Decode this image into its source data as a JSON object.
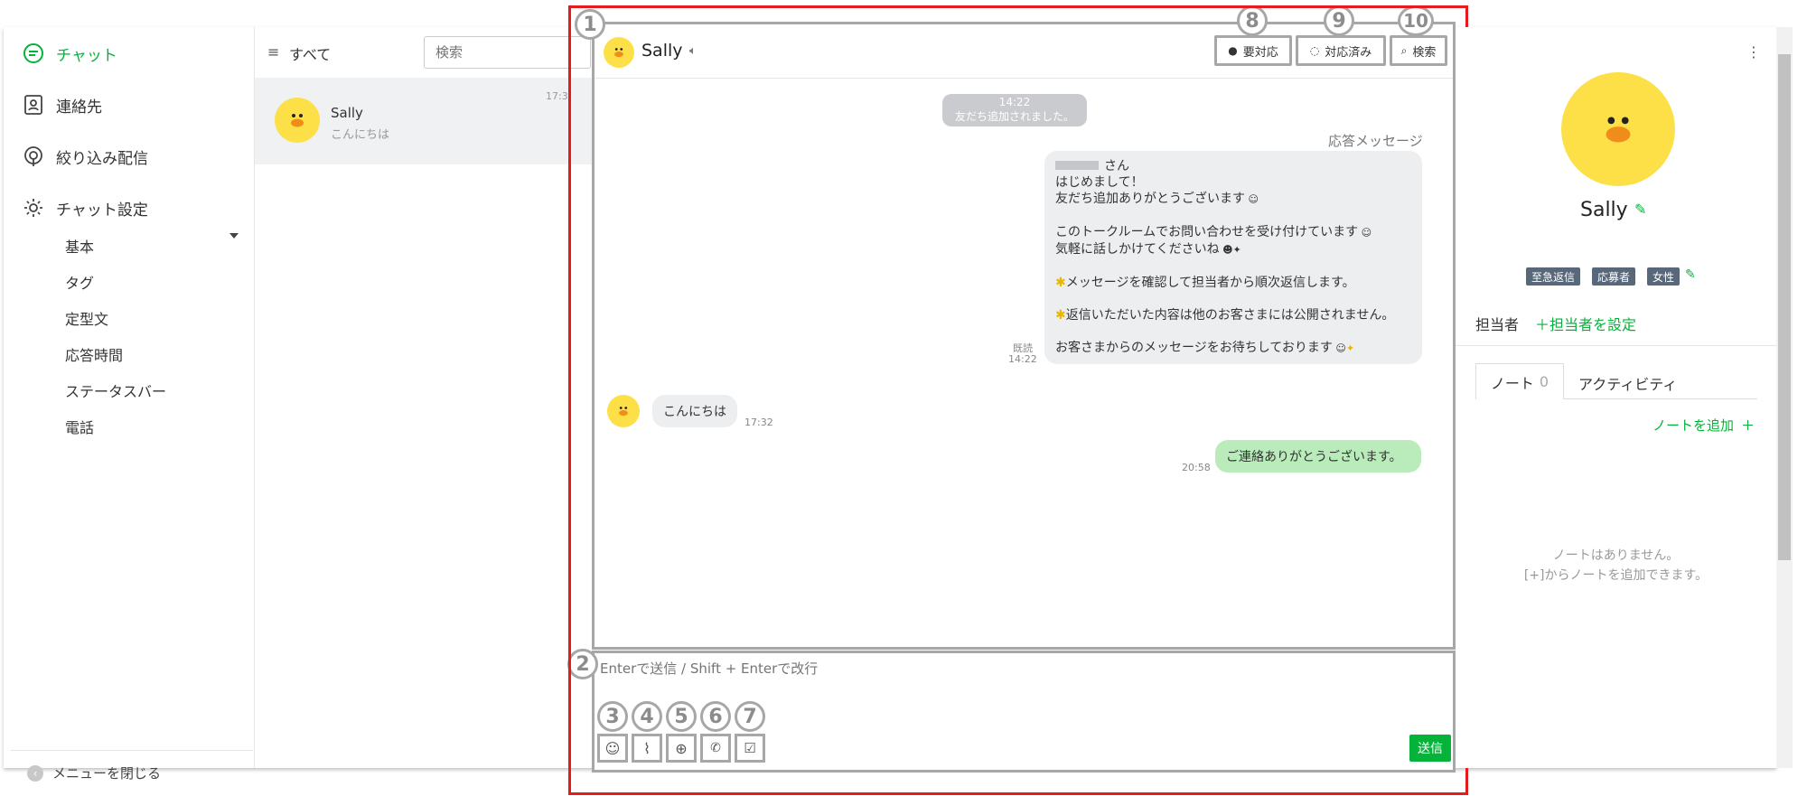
{
  "nav": {
    "items": [
      {
        "label": "チャット",
        "icon": "chat-icon",
        "active": true
      },
      {
        "label": "連絡先",
        "icon": "contacts-icon"
      },
      {
        "label": "絞り込み配信",
        "icon": "broadcast-icon"
      },
      {
        "label": "チャット設定",
        "icon": "gear-icon"
      }
    ],
    "sub_items": [
      "基本",
      "タグ",
      "定型文",
      "応答時間",
      "ステータスバー",
      "電話"
    ],
    "close_label": "メニューを閉じる"
  },
  "list": {
    "filter_label": "すべて",
    "search_placeholder": "検索",
    "rows": [
      {
        "name": "Sally",
        "preview": "こんにちは",
        "time": "17:3"
      }
    ]
  },
  "chat": {
    "name": "Sally",
    "buttons": {
      "pending": "要対応",
      "done": "対応済み",
      "search": "検索"
    },
    "system": {
      "time": "14:22",
      "text": "友だち追加されました。"
    },
    "auto_label": "応答メッセージ",
    "auto_lines": [
      "さん",
      "はじめまして！",
      "友だち追加ありがとうございます",
      "",
      "このトークルームでお問い合わせを受け付けています",
      "気軽に話しかけてくださいね",
      "",
      "メッセージを確認して担当者から順次返信します。",
      "",
      "返信いただいた内容は他のお客さまには公開されません。",
      "",
      "お客さまからのメッセージをお待ちしております"
    ],
    "read_label": "既読",
    "auto_time": "14:22",
    "incoming": {
      "text": "こんにちは",
      "time": "17:32"
    },
    "outgoing": {
      "text": "ご連絡ありがとうございます。",
      "time": "20:58"
    }
  },
  "input": {
    "placeholder": "Enterで送信 / Shift + Enterで改行",
    "send_label": "送信"
  },
  "callouts": [
    "1",
    "2",
    "3",
    "4",
    "5",
    "6",
    "7",
    "8",
    "9",
    "10"
  ],
  "profile": {
    "name": "Sally",
    "tags": [
      "至急返信",
      "応募者",
      "女性"
    ],
    "assignee_label": "担当者",
    "assign_action": "＋担当者を設定",
    "tabs": [
      {
        "label": "ノート",
        "count": "0"
      },
      {
        "label": "アクティビティ"
      }
    ],
    "add_note": "ノートを追加",
    "empty_line1": "ノートはありません。",
    "empty_line2": "[+]からノートを追加できます。"
  },
  "colors": {
    "accent": "#06b33a",
    "callout": "#a7a7a7",
    "highlight": "#e31d1d",
    "bubble_me": "#b9ebbb",
    "tag": "#58677a"
  }
}
